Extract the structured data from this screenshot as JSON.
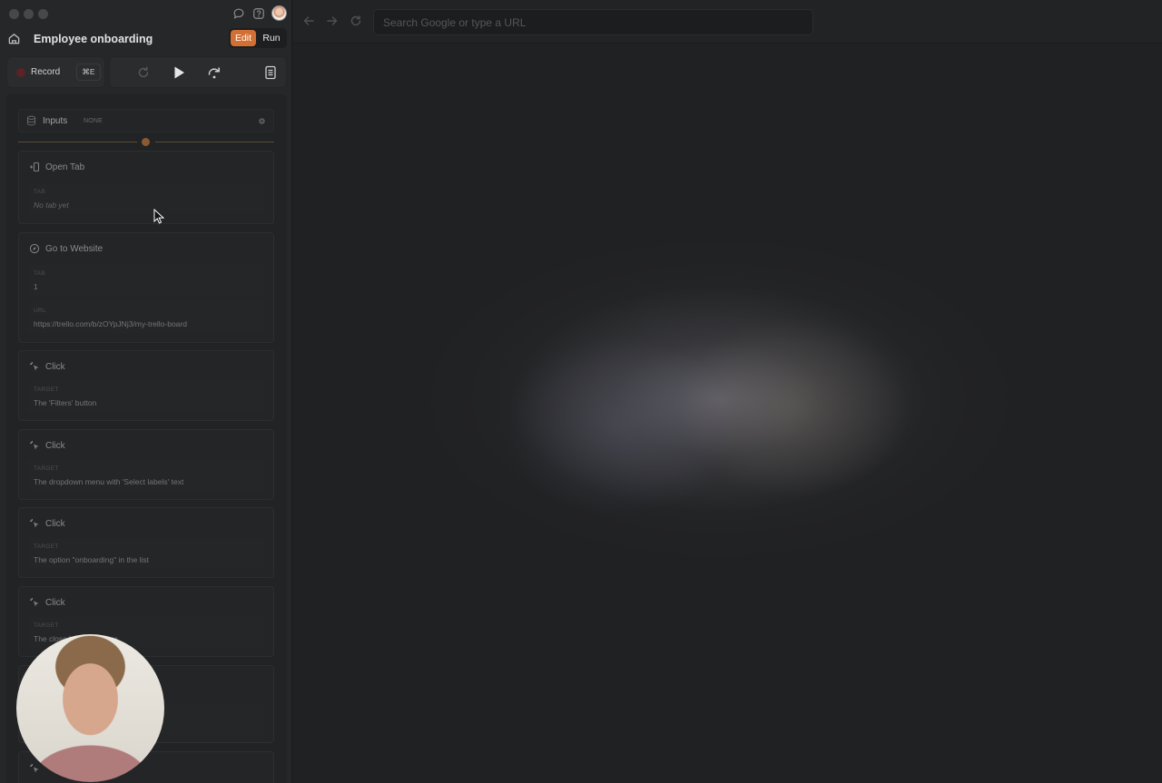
{
  "window": {
    "controls": [
      "close",
      "minimize",
      "maximize"
    ]
  },
  "header": {
    "title": "Employee onboarding",
    "mode": {
      "edit_label": "Edit",
      "run_label": "Run",
      "active": "Edit"
    },
    "icons": [
      "chat-bubble-icon",
      "help-icon"
    ]
  },
  "recorder": {
    "record_label": "Record",
    "shortcut": "⌘E"
  },
  "controls": {
    "icons": [
      "reset-icon",
      "play-icon",
      "step-forward-icon",
      "notes-icon"
    ]
  },
  "inputs": {
    "label": "Inputs",
    "badge": "NONE"
  },
  "steps": [
    {
      "icon": "open-tab-icon",
      "title": "Open Tab",
      "fields": [
        {
          "label": "TAB",
          "value": "No tab yet",
          "placeholder": true
        }
      ]
    },
    {
      "icon": "compass-icon",
      "title": "Go to Website",
      "fields": [
        {
          "label": "TAB",
          "value": "1"
        },
        {
          "label": "URL",
          "value": "https://trello.com/b/zOYpJNj3/my-trello-board"
        }
      ]
    },
    {
      "icon": "click-icon",
      "title": "Click",
      "fields": [
        {
          "label": "TARGET",
          "value": "The 'Filters' button"
        }
      ]
    },
    {
      "icon": "click-icon",
      "title": "Click",
      "fields": [
        {
          "label": "TARGET",
          "value": "The dropdown menu with 'Select labels' text"
        }
      ]
    },
    {
      "icon": "click-icon",
      "title": "Click",
      "fields": [
        {
          "label": "TARGET",
          "value": "The option \"onboarding\" in the list"
        }
      ]
    },
    {
      "icon": "click-icon",
      "title": "Click",
      "fields": [
        {
          "label": "TARGET",
          "value": "The close ⟍ the popover"
        }
      ]
    }
  ],
  "browser": {
    "url_placeholder": "Search Google or type a URL",
    "url_value": ""
  },
  "colors": {
    "accent": "#d36f32",
    "record": "#5c2226",
    "panel": "#262729",
    "background": "#1e1f21"
  }
}
